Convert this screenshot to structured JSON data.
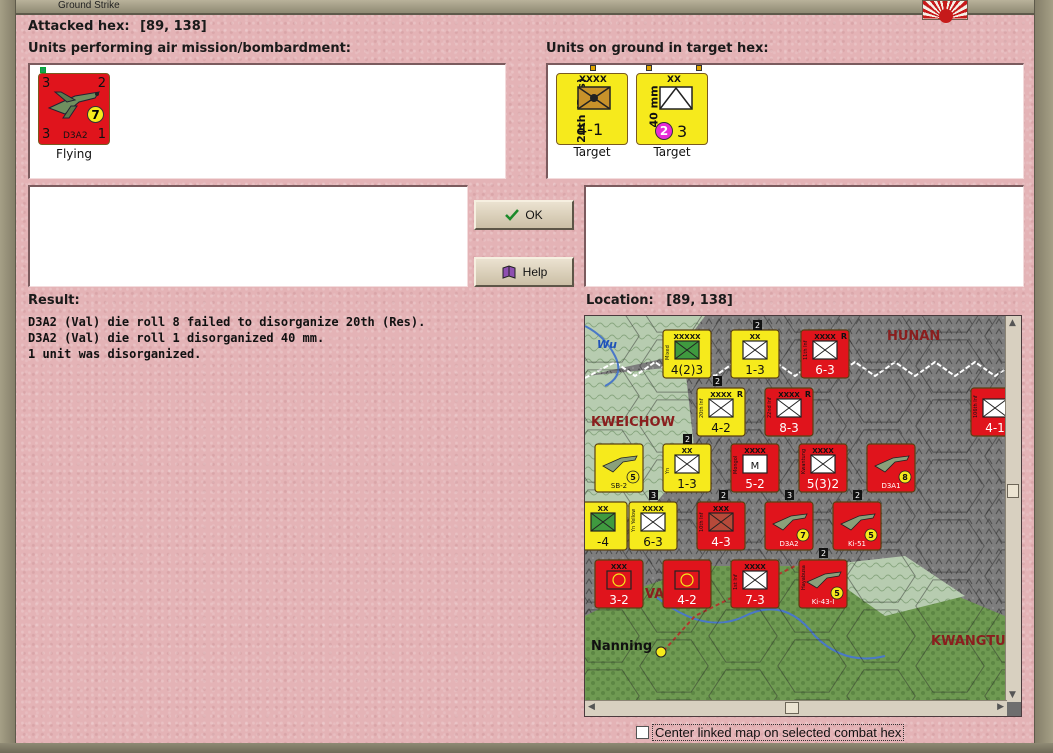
{
  "window": {
    "title": "Ground Strike"
  },
  "header": {
    "attacked_hex_label": "Attacked hex:",
    "attacked_hex_value": "[89, 138]"
  },
  "air_units": {
    "label": "Units performing air mission/bombardment:",
    "units": [
      {
        "name": "D3A2",
        "status": "Flying",
        "top_left": "3",
        "top_right": "2",
        "bottom_left": "3",
        "bottom_right": "1",
        "badge": "7",
        "color": "#e0141c"
      }
    ]
  },
  "ground_units": {
    "label": "Units on ground in target hex:",
    "units": [
      {
        "name": "20th (Res)",
        "size": "XXXX",
        "strength": "4-1",
        "status": "Target",
        "color": "#f6ea1c"
      },
      {
        "name": "40 mm",
        "size": "XX",
        "badge": "2",
        "strength": "3",
        "status": "Target",
        "color": "#f6ea1c"
      }
    ]
  },
  "buttons": {
    "ok_label": "OK",
    "help_label": "Help"
  },
  "result": {
    "label": "Result:",
    "lines": [
      "D3A2 (Val) die roll 8 failed to disorganize 20th (Res).",
      "D3A2 (Val) die roll 1 disorganized 40 mm.",
      "1 unit was disorganized."
    ]
  },
  "location": {
    "label": "Location:",
    "value": "[89, 138]"
  },
  "map": {
    "regions": [
      "HUNAN",
      "KWEICHOW",
      "KWANGTU"
    ],
    "river": "Wu",
    "city": "Nanning",
    "fragment": "VA",
    "counters": [
      {
        "label": "4(2)3",
        "unit": "Mixed",
        "size": "XXXXX",
        "color": "#f6ea1c",
        "symbol": "armor"
      },
      {
        "label": "1-3",
        "size": "XX",
        "color": "#f6ea1c",
        "symbol": "infantry"
      },
      {
        "label": "6-3",
        "unit": "11th Inf",
        "size": "XXXX",
        "color": "#e0141c",
        "symbol": "infantry",
        "badge": "R"
      },
      {
        "label": "4-2",
        "unit": "20th Inf",
        "size": "XXXX",
        "color": "#f6ea1c",
        "symbol": "infantry",
        "badge": "R"
      },
      {
        "label": "8-3",
        "unit": "22nd Inf",
        "size": "XXXX",
        "color": "#e0141c",
        "symbol": "infantry",
        "badge": "R"
      },
      {
        "label": "4-1",
        "unit": "106th Inf",
        "color": "#e0141c",
        "symbol": "infantry"
      },
      {
        "label": "1-3",
        "unit": "Yn",
        "size": "XX",
        "color": "#f6ea1c",
        "symbol": "infantry"
      },
      {
        "label": "5-2",
        "unit": "Mongol",
        "size": "XXXX",
        "color": "#e0141c",
        "symbol": "cavalry"
      },
      {
        "label": "5(3)2",
        "unit": "Kwantung",
        "size": "XXXX",
        "color": "#e0141c",
        "symbol": "infantry"
      },
      {
        "label": "SB-2",
        "color": "#f6ea1c",
        "symbol": "aircraft",
        "badge": "5"
      },
      {
        "label": "D3A1",
        "color": "#e0141c",
        "symbol": "aircraft",
        "badge": "8"
      },
      {
        "label": "-4",
        "size": "XX",
        "color": "#f6ea1c",
        "symbol": "armor"
      },
      {
        "label": "6-3",
        "unit": "Yn Yellow",
        "size": "XXXX",
        "color": "#f6ea1c",
        "symbol": "infantry"
      },
      {
        "label": "4-3",
        "unit": "10th Inf",
        "size": "XXX",
        "color": "#e0141c",
        "symbol": "armor"
      },
      {
        "label": "D3A2",
        "color": "#e0141c",
        "symbol": "aircraft",
        "badge": "7"
      },
      {
        "label": "Ki-51",
        "color": "#e0141c",
        "symbol": "aircraft",
        "badge": "5"
      },
      {
        "label": "3-2",
        "size": "XXX",
        "color": "#e0141c",
        "symbol": "hq"
      },
      {
        "label": "4-2",
        "color": "#e0141c",
        "symbol": "hq"
      },
      {
        "label": "7-3",
        "unit": "1st Inf",
        "size": "XXXX",
        "color": "#e0141c",
        "symbol": "infantry"
      },
      {
        "label": "Ki-43-I",
        "unit": "Hayabusa",
        "color": "#e0141c",
        "symbol": "aircraft",
        "badge": "5"
      }
    ],
    "stack_badges": [
      "2",
      "2",
      "2",
      "3",
      "2",
      "3",
      "2",
      "2"
    ]
  },
  "options": {
    "center_linked_map": "Center linked map on selected combat hex"
  }
}
